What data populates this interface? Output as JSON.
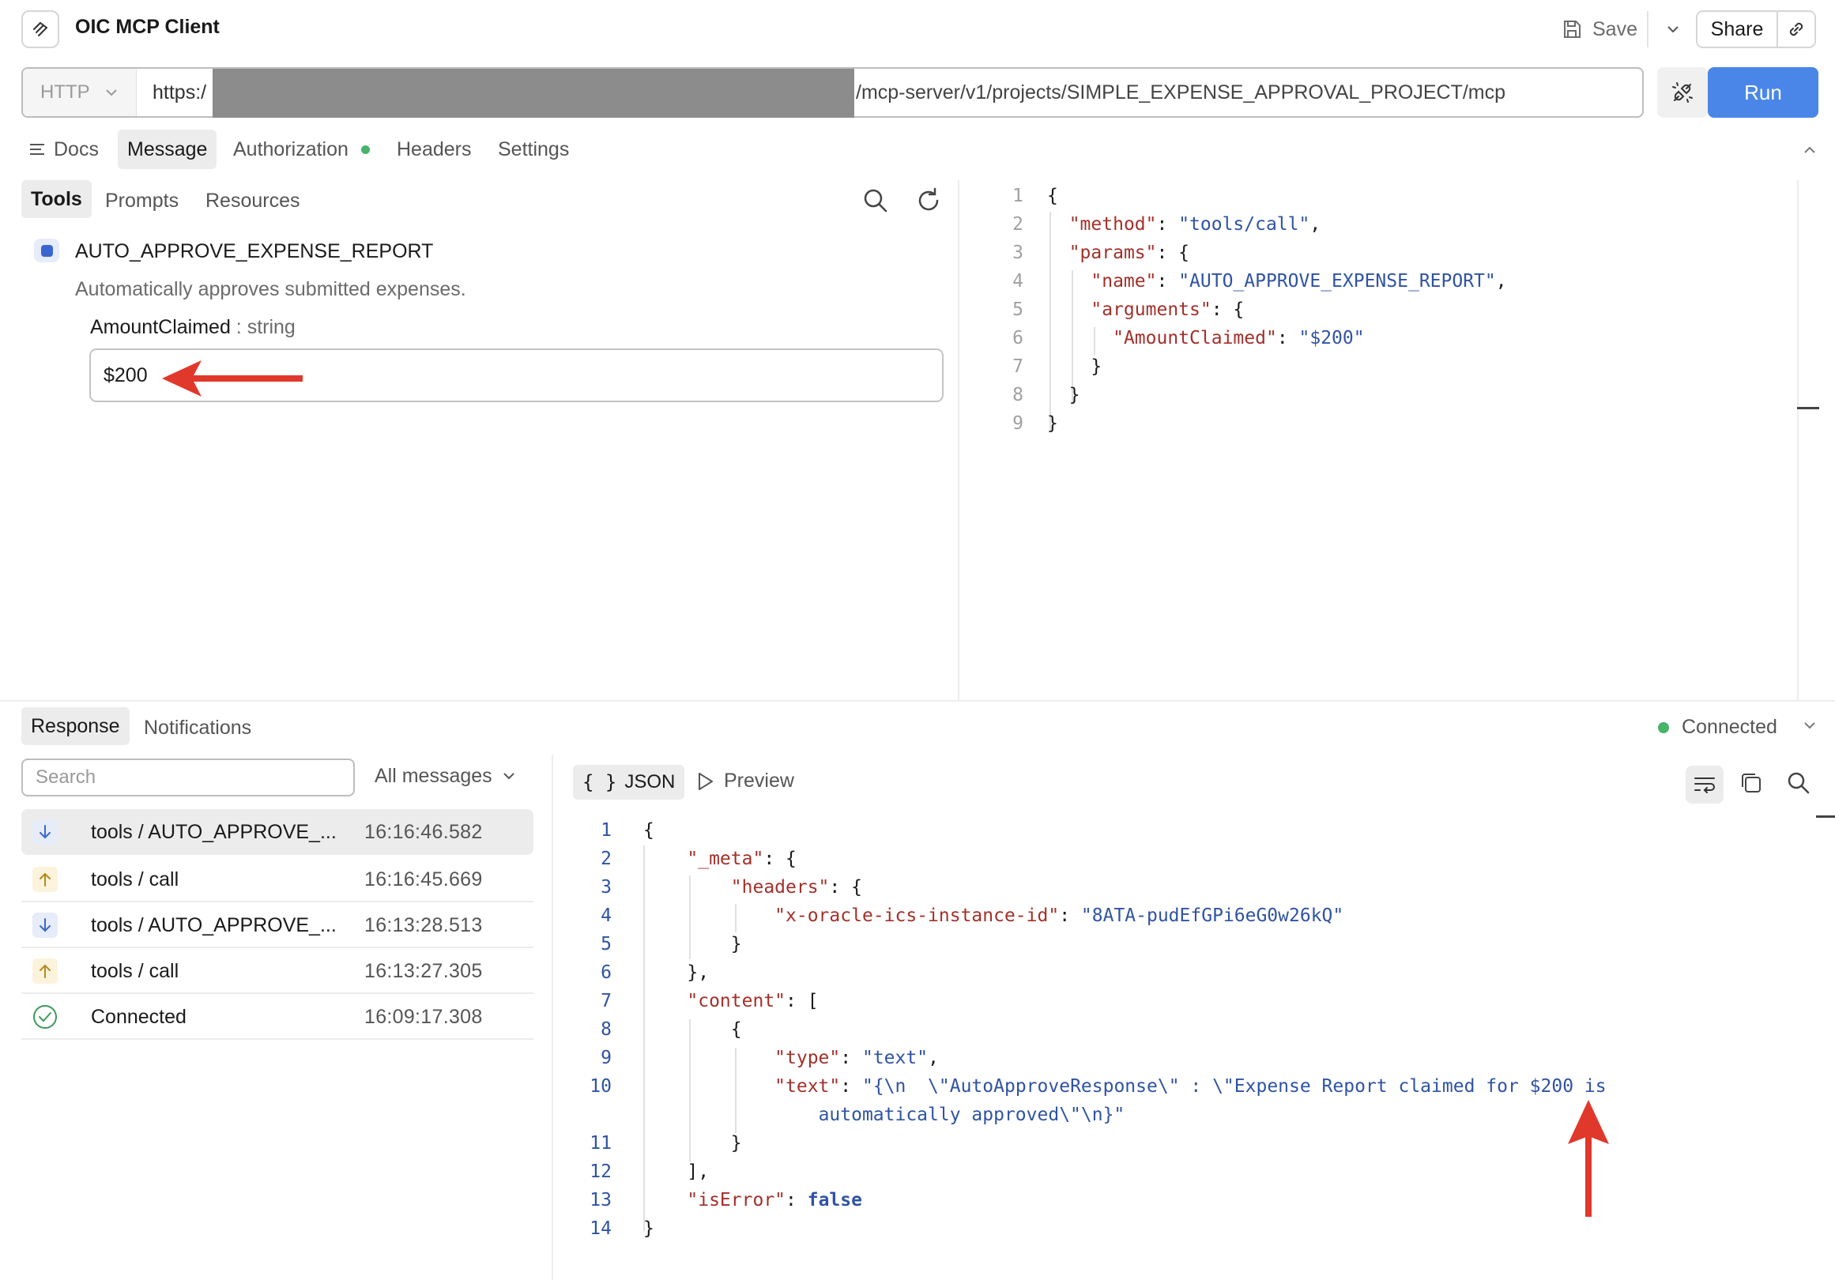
{
  "app": {
    "title": "OIC MCP Client"
  },
  "toolbar": {
    "save_label": "Save",
    "share_label": "Share"
  },
  "request": {
    "method": "HTTP",
    "url_prefix": "https:/",
    "url_suffix": "/mcp-server/v1/projects/SIMPLE_EXPENSE_APPROVAL_PROJECT/mcp",
    "run_label": "Run"
  },
  "tabs": {
    "docs": "Docs",
    "message": "Message",
    "authorization": "Authorization",
    "headers": "Headers",
    "settings": "Settings"
  },
  "subtabs": {
    "tools": "Tools",
    "prompts": "Prompts",
    "resources": "Resources"
  },
  "tool": {
    "name": "AUTO_APPROVE_EXPENSE_REPORT",
    "description": "Automatically approves submitted expenses.",
    "param_name": "AmountClaimed",
    "param_type": " : string",
    "param_value": "$200"
  },
  "request_json": {
    "line_numbers": [
      "1",
      "2",
      "3",
      "4",
      "5",
      "6",
      "7",
      "8",
      "9"
    ],
    "method_key": "\"method\"",
    "method_val": "\"tools/call\"",
    "params_key": "\"params\"",
    "name_key": "\"name\"",
    "name_val": "\"AUTO_APPROVE_EXPENSE_REPORT\"",
    "arguments_key": "\"arguments\"",
    "amount_key": "\"AmountClaimed\"",
    "amount_val": "\"$200\""
  },
  "response": {
    "tab_response": "Response",
    "tab_notifications": "Notifications",
    "status": "Connected",
    "search_placeholder": "Search",
    "filter": "All messages",
    "view_json": "JSON",
    "view_preview": "Preview",
    "log": [
      {
        "direction": "down",
        "label": "tools / AUTO_APPROVE_...",
        "time": "16:16:46.582"
      },
      {
        "direction": "up",
        "label": "tools / call",
        "time": "16:16:45.669"
      },
      {
        "direction": "down",
        "label": "tools / AUTO_APPROVE_...",
        "time": "16:13:28.513"
      },
      {
        "direction": "up",
        "label": "tools / call",
        "time": "16:13:27.305"
      },
      {
        "direction": "connected",
        "label": "Connected",
        "time": "16:09:17.308"
      }
    ]
  },
  "response_json": {
    "line_numbers": [
      "1",
      "2",
      "3",
      "4",
      "5",
      "6",
      "7",
      "8",
      "9",
      "10",
      "",
      "11",
      "12",
      "13",
      "14"
    ],
    "meta_key": "\"_meta\"",
    "headers_key": "\"headers\"",
    "instance_key": "\"x-oracle-ics-instance-id\"",
    "instance_val": "\"8ATA-pudEfGPi6eG0w26kQ\"",
    "content_key": "\"content\"",
    "type_key": "\"type\"",
    "type_val": "\"text\"",
    "text_key": "\"text\"",
    "text_val_1": "\"{\\n  \\\"AutoApproveResponse\\\" : \\\"Expense Report claimed for $200 is",
    "text_val_2": "automatically approved\\\"\\n}\"",
    "is_error_key": "\"isError\"",
    "is_error_val": "false"
  },
  "colors": {
    "accent": "#4a86e8",
    "status_ok": "#47b36b",
    "annotation_arrow": "#e0382b"
  }
}
